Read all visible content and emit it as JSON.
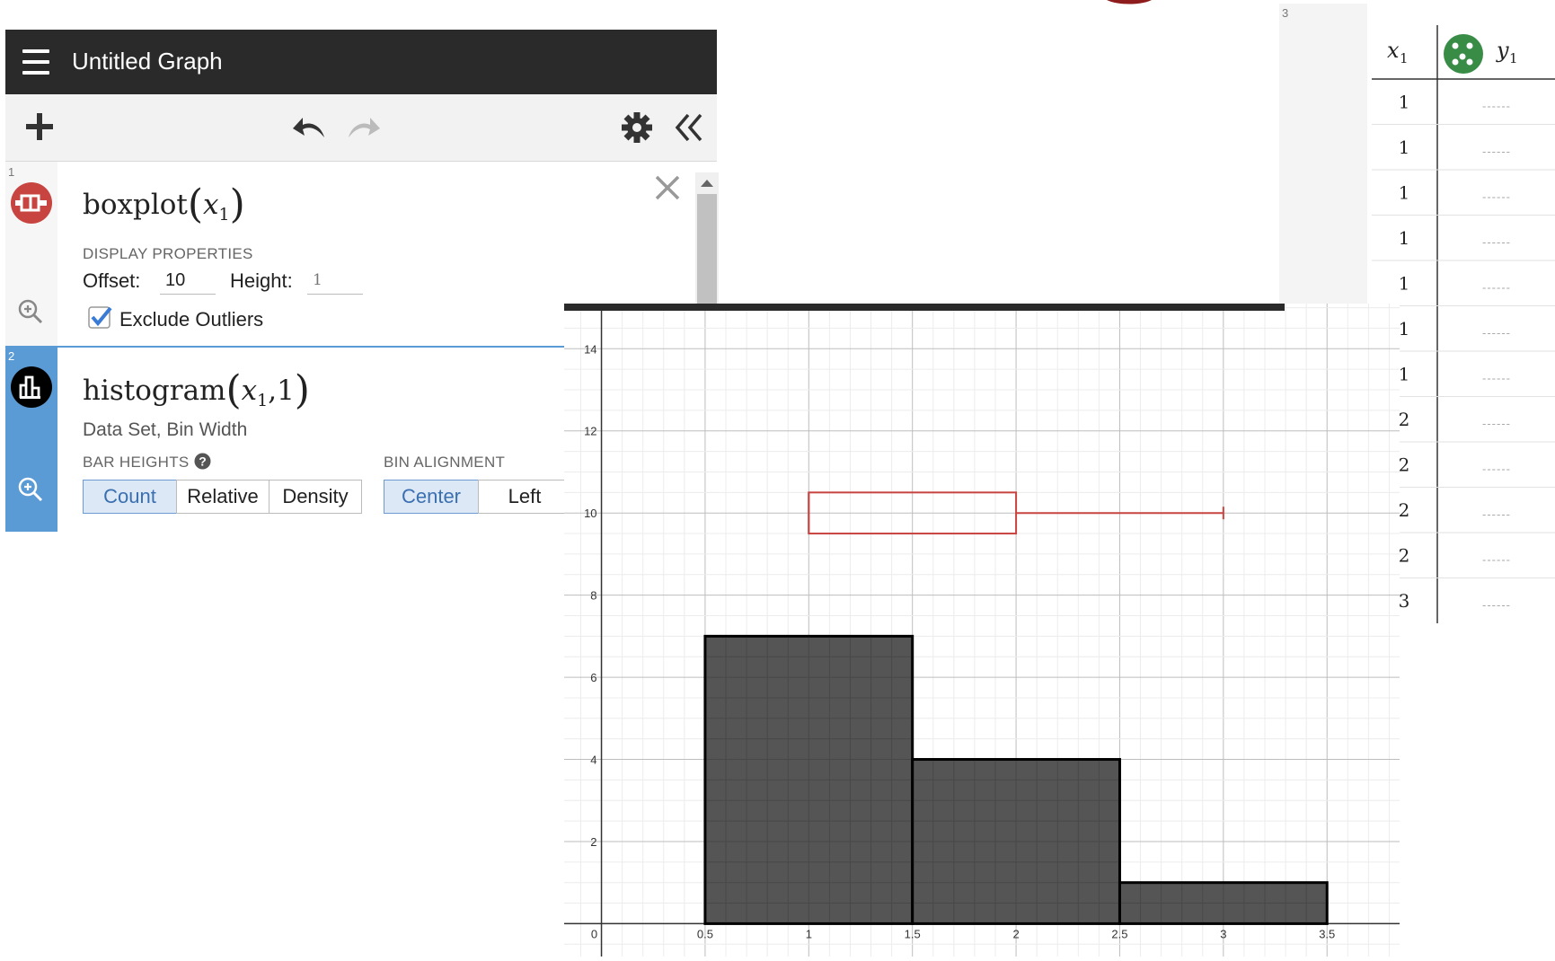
{
  "header": {
    "title": "Untitled Graph"
  },
  "expressions": [
    {
      "number": "1",
      "name": "boxplot",
      "arg": "x",
      "arg_sub": "1",
      "display_properties_label": "DISPLAY PROPERTIES",
      "offset_label": "Offset:",
      "offset_value": "10",
      "height_label": "Height:",
      "height_value": "1",
      "exclude_outliers_label": "Exclude Outliers",
      "exclude_outliers_checked": true,
      "color": "#c74440"
    },
    {
      "number": "2",
      "name": "histogram",
      "arg": "x",
      "arg_sub": "1",
      "arg2": "1",
      "hint": "Data Set, Bin Width",
      "bar_heights_label": "BAR HEIGHTS",
      "bar_heights_options": [
        "Count",
        "Relative",
        "Density"
      ],
      "bar_heights_selected": "Count",
      "bin_alignment_label": "BIN ALIGNMENT",
      "bin_alignment_options": [
        "Center",
        "Left"
      ],
      "bin_alignment_selected": "Center",
      "color": "#000000"
    }
  ],
  "table": {
    "row_number": "3",
    "col1_header": "x",
    "col1_sub": "1",
    "col2_header": "y",
    "col2_sub": "1",
    "series_color": "#388c46",
    "x_values": [
      "1",
      "1",
      "1",
      "1",
      "1",
      "1",
      "1",
      "2",
      "2",
      "2",
      "2",
      "3"
    ],
    "y_placeholder": "------"
  },
  "chart_data": {
    "type": "bar",
    "histogram": {
      "bins": [
        {
          "start": 0.5,
          "end": 1.5,
          "count": 7
        },
        {
          "start": 1.5,
          "end": 2.5,
          "count": 4
        },
        {
          "start": 2.5,
          "end": 3.5,
          "count": 1
        }
      ],
      "fill": "#555555"
    },
    "boxplot": {
      "min": 1,
      "q1": 1,
      "median": 1,
      "q3": 2,
      "max": 3,
      "offset": 10,
      "height": 1,
      "color": "#c74440"
    },
    "xlim": [
      -0.18,
      3.85
    ],
    "ylim": [
      -0.8,
      15.1
    ],
    "x_ticks": [
      {
        "value": 0,
        "label": "0"
      },
      {
        "value": 0.5,
        "label": "0.5"
      },
      {
        "value": 1,
        "label": "1"
      },
      {
        "value": 1.5,
        "label": "1.5"
      },
      {
        "value": 2,
        "label": "2"
      },
      {
        "value": 2.5,
        "label": "2.5"
      },
      {
        "value": 3,
        "label": "3"
      },
      {
        "value": 3.5,
        "label": "3.5"
      }
    ],
    "y_ticks": [
      {
        "value": 2,
        "label": "2"
      },
      {
        "value": 4,
        "label": "4"
      },
      {
        "value": 6,
        "label": "6"
      },
      {
        "value": 8,
        "label": "8"
      },
      {
        "value": 10,
        "label": "10"
      },
      {
        "value": 12,
        "label": "12"
      },
      {
        "value": 14,
        "label": "14"
      }
    ],
    "grid": true
  }
}
